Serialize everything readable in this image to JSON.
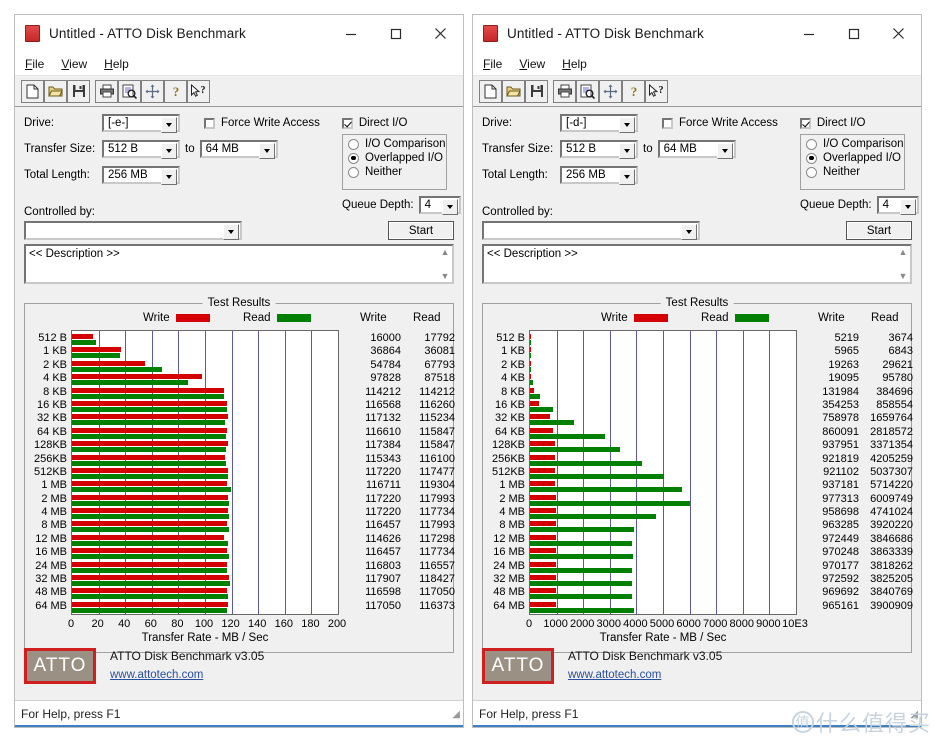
{
  "watermark": {
    "circle_char": "值",
    "text": "什么值得买"
  },
  "windows": [
    {
      "id": "left",
      "title": "Untitled - ATTO Disk Benchmark",
      "minimize_label": "–",
      "maximize_label": "□",
      "close_label": "✕",
      "menu": [
        "File",
        "View",
        "Help"
      ],
      "toolbar_icons": [
        "new-document-icon",
        "open-folder-icon",
        "save-floppy-icon",
        "print-icon",
        "print-preview-icon",
        "move-icon",
        "help-icon",
        "context-help-icon"
      ],
      "form": {
        "drive_label": "Drive:",
        "drive_value": "[-e-]",
        "transfer_size_label": "Transfer Size:",
        "transfer_size_from": "512 B",
        "to_label": "to",
        "transfer_size_to": "64 MB",
        "total_length_label": "Total Length:",
        "total_length_value": "256 MB",
        "force_write_label": "Force Write Access",
        "force_write_checked": false,
        "direct_io_label": "Direct I/O",
        "direct_io_checked": true,
        "io_comparison_label": "I/O Comparison",
        "overlapped_io_label": "Overlapped I/O",
        "neither_label": "Neither",
        "io_mode_selected": "Overlapped I/O",
        "queue_depth_label": "Queue Depth:",
        "queue_depth_value": "4",
        "controlled_by_label": "Controlled by:",
        "controlled_by_value": "",
        "start_label": "Start",
        "description_value": "<< Description >>"
      },
      "results": {
        "group_title": "Test Results",
        "write_legend": "Write",
        "read_legend": "Read",
        "write_col_header": "Write",
        "read_col_header": "Read"
      },
      "brand": {
        "logo_text": "ATTO",
        "version_text": "ATTO Disk Benchmark v3.05",
        "url_text": "www.attotech.com"
      },
      "status_text": "For Help, press F1",
      "chart_data": {
        "type": "bar",
        "title": "Test Results",
        "xlabel": "Transfer Rate - MB / Sec",
        "ylabel": "",
        "orientation": "horizontal",
        "xlim": [
          0,
          200
        ],
        "xticks": [
          "0",
          "20",
          "40",
          "60",
          "80",
          "100",
          "120",
          "140",
          "160",
          "180",
          "200"
        ],
        "xtick_values": [
          0,
          20,
          40,
          60,
          80,
          100,
          120,
          140,
          160,
          180,
          200
        ],
        "grid": true,
        "legend": [
          "Write",
          "Read"
        ],
        "legend_colors": [
          "#d40000",
          "#008000"
        ],
        "units": "KB/s",
        "categories": [
          "512 B",
          "1 KB",
          "2 KB",
          "4 KB",
          "8 KB",
          "16 KB",
          "32 KB",
          "64 KB",
          "128KB",
          "256KB",
          "512KB",
          "1 MB",
          "2 MB",
          "4 MB",
          "8 MB",
          "12 MB",
          "16 MB",
          "24 MB",
          "32 MB",
          "48 MB",
          "64 MB"
        ],
        "series": [
          {
            "name": "Write",
            "color": "#d40000",
            "values": [
              16000,
              36864,
              54784,
              97828,
              114212,
              116568,
              117132,
              116610,
              117384,
              115343,
              117220,
              116711,
              117220,
              117220,
              116457,
              114626,
              116457,
              116803,
              117907,
              116598,
              117050
            ]
          },
          {
            "name": "Read",
            "color": "#008000",
            "values": [
              17792,
              36081,
              67793,
              87518,
              114212,
              116260,
              115234,
              115847,
              115847,
              116100,
              117477,
              119304,
              117993,
              117734,
              117993,
              117298,
              117734,
              116557,
              118427,
              117050,
              116373
            ]
          }
        ]
      }
    },
    {
      "id": "right",
      "title": "Untitled - ATTO Disk Benchmark",
      "minimize_label": "–",
      "maximize_label": "□",
      "close_label": "✕",
      "menu": [
        "File",
        "View",
        "Help"
      ],
      "toolbar_icons": [
        "new-document-icon",
        "open-folder-icon",
        "save-floppy-icon",
        "print-icon",
        "print-preview-icon",
        "move-icon",
        "help-icon",
        "context-help-icon"
      ],
      "form": {
        "drive_label": "Drive:",
        "drive_value": "[-d-]",
        "transfer_size_label": "Transfer Size:",
        "transfer_size_from": "512 B",
        "to_label": "to",
        "transfer_size_to": "64 MB",
        "total_length_label": "Total Length:",
        "total_length_value": "256 MB",
        "force_write_label": "Force Write Access",
        "force_write_checked": false,
        "direct_io_label": "Direct I/O",
        "direct_io_checked": true,
        "io_comparison_label": "I/O Comparison",
        "overlapped_io_label": "Overlapped I/O",
        "neither_label": "Neither",
        "io_mode_selected": "Overlapped I/O",
        "queue_depth_label": "Queue Depth:",
        "queue_depth_value": "4",
        "controlled_by_label": "Controlled by:",
        "controlled_by_value": "",
        "start_label": "Start",
        "description_value": "<< Description >>"
      },
      "results": {
        "group_title": "Test Results",
        "write_legend": "Write",
        "read_legend": "Read",
        "write_col_header": "Write",
        "read_col_header": "Read"
      },
      "brand": {
        "logo_text": "ATTO",
        "version_text": "ATTO Disk Benchmark v3.05",
        "url_text": "www.attotech.com"
      },
      "status_text": "For Help, press F1",
      "chart_data": {
        "type": "bar",
        "title": "Test Results",
        "xlabel": "Transfer Rate - MB / Sec",
        "ylabel": "",
        "orientation": "horizontal",
        "xlim": [
          0,
          10000
        ],
        "xticks": [
          "0",
          "1000",
          "2000",
          "3000",
          "4000",
          "5000",
          "6000",
          "7000",
          "8000",
          "9000",
          "10E3"
        ],
        "xtick_values": [
          0,
          1000,
          2000,
          3000,
          4000,
          5000,
          6000,
          7000,
          8000,
          9000,
          10000
        ],
        "grid": true,
        "legend": [
          "Write",
          "Read"
        ],
        "legend_colors": [
          "#d40000",
          "#008000"
        ],
        "units": "KB/s",
        "categories": [
          "512 B",
          "1 KB",
          "2 KB",
          "4 KB",
          "8 KB",
          "16 KB",
          "32 KB",
          "64 KB",
          "128KB",
          "256KB",
          "512KB",
          "1 MB",
          "2 MB",
          "4 MB",
          "8 MB",
          "12 MB",
          "16 MB",
          "24 MB",
          "32 MB",
          "48 MB",
          "64 MB"
        ],
        "series": [
          {
            "name": "Write",
            "color": "#d40000",
            "values": [
              5219,
              5965,
              19263,
              19095,
              131984,
              354253,
              758978,
              860091,
              937951,
              921819,
              921102,
              937181,
              977313,
              958698,
              963285,
              972449,
              970248,
              970177,
              972592,
              969692,
              965161
            ]
          },
          {
            "name": "Read",
            "color": "#008000",
            "values": [
              3674,
              6843,
              29621,
              95780,
              384696,
              858554,
              1659764,
              2818572,
              3371354,
              4205259,
              5037307,
              5714220,
              6009749,
              4741024,
              3920220,
              3846686,
              3863339,
              3818262,
              3825205,
              3840769,
              3900909
            ]
          }
        ]
      }
    }
  ]
}
